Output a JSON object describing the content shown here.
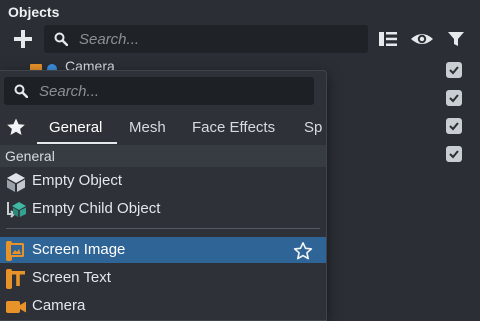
{
  "panel": {
    "title": "Objects"
  },
  "top_search": {
    "placeholder": "Search..."
  },
  "toolbar": {
    "icons": [
      "add-icon",
      "list-icon",
      "eye-icon",
      "filter-icon"
    ]
  },
  "scene_rows": [
    {
      "label": "Camera",
      "checked": true
    },
    {
      "checked": true
    },
    {
      "checked": true
    },
    {
      "checked": true
    }
  ],
  "add_menu": {
    "search_placeholder": "Search...",
    "tabs": [
      "General",
      "Mesh",
      "Face Effects",
      "Sp"
    ],
    "active_tab": "General",
    "section": "General",
    "items_group1": [
      {
        "label": "Empty Object",
        "icon": "empty-object-icon"
      },
      {
        "label": "Empty Child Object",
        "icon": "empty-child-object-icon"
      }
    ],
    "items_group2": [
      {
        "label": "Screen Image",
        "icon": "screen-image-icon",
        "selected": true
      },
      {
        "label": "Screen Text",
        "icon": "screen-text-icon"
      },
      {
        "label": "Camera",
        "icon": "camera-icon"
      }
    ]
  },
  "colors": {
    "background": "#2b2f35",
    "selection": "#2f6496",
    "accent_orange": "#e8922a",
    "accent_teal": "#3fb8a4",
    "camera_blue": "#3b8fe0"
  }
}
